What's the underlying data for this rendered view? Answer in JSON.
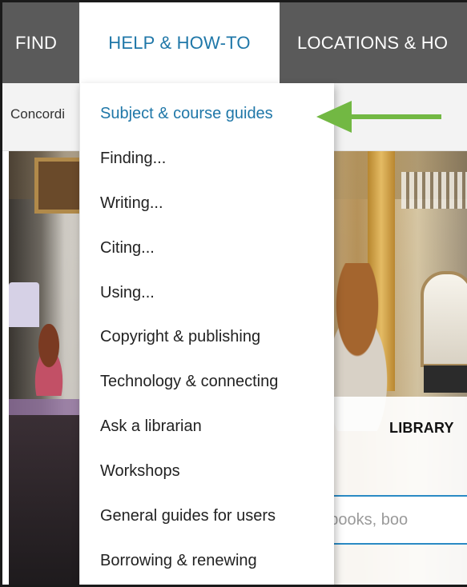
{
  "nav": {
    "find": "FIND",
    "help": "HELP & HOW-TO",
    "locations": "LOCATIONS & HO"
  },
  "breadcrumb": "Concordi",
  "menu": {
    "items": [
      {
        "label": "Subject & course guides",
        "active": true
      },
      {
        "label": "Finding...",
        "active": false
      },
      {
        "label": "Writing...",
        "active": false
      },
      {
        "label": "Citing...",
        "active": false
      },
      {
        "label": "Using...",
        "active": false
      },
      {
        "label": "Copyright & publishing",
        "active": false
      },
      {
        "label": "Technology & connecting",
        "active": false
      },
      {
        "label": "Ask a librarian",
        "active": false
      },
      {
        "label": "Workshops",
        "active": false
      },
      {
        "label": "General guides for users",
        "active": false
      },
      {
        "label": "Borrowing & renewing",
        "active": false
      }
    ]
  },
  "search": {
    "panel_title": "LIBRARY",
    "placeholder": "s, ebooks, boo"
  },
  "colors": {
    "nav_bg": "#5a5a5a",
    "accent": "#1f77a8",
    "arrow": "#72b843"
  }
}
